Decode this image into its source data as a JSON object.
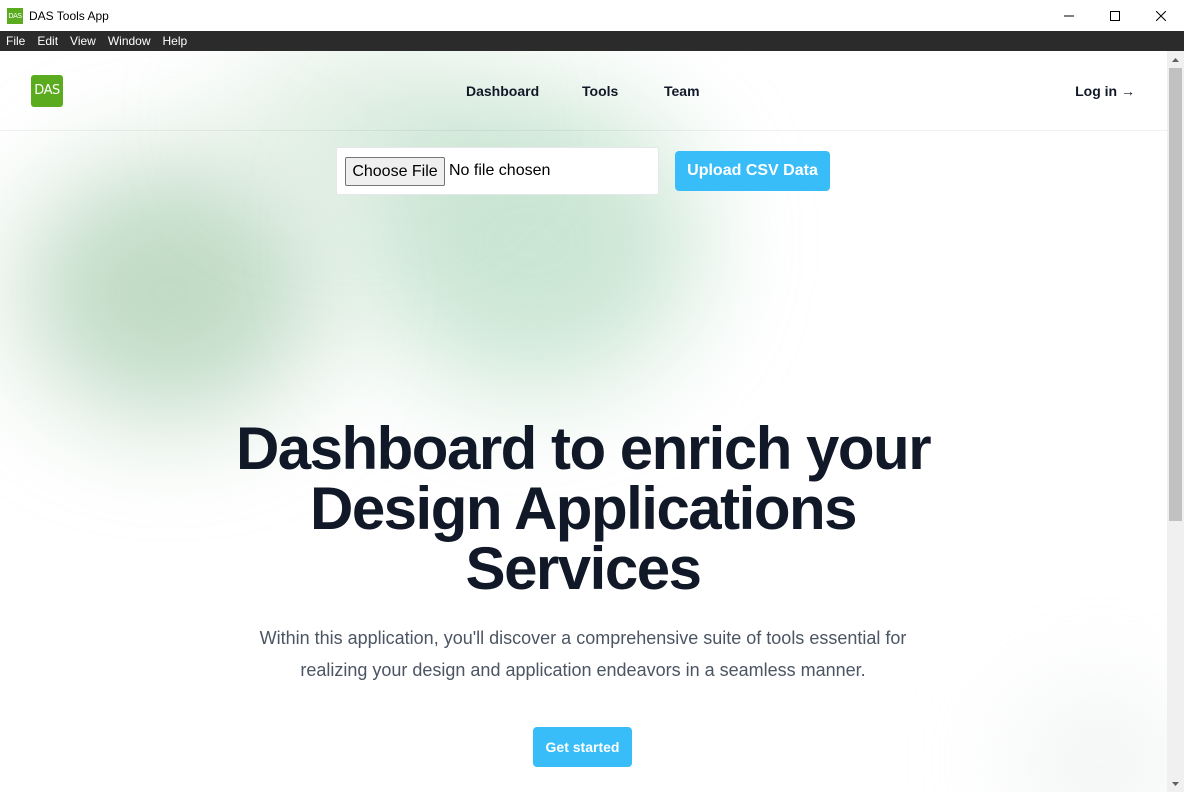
{
  "window": {
    "app_icon_text": "DAS",
    "title": "DAS Tools App"
  },
  "menu": {
    "items": [
      "File",
      "Edit",
      "View",
      "Window",
      "Help"
    ]
  },
  "header": {
    "logo_text": "DAS",
    "nav": [
      "Dashboard",
      "Tools",
      "Team"
    ],
    "login_label": "Log in →"
  },
  "upload": {
    "choose_label": "Choose File",
    "file_status": "No file chosen",
    "upload_label": "Upload CSV Data"
  },
  "hero": {
    "title_lines": [
      "Dashboard to enrich your",
      "Design Applications",
      "Services"
    ],
    "subtitle_lines": [
      "Within this application, you'll discover a comprehensive suite of tools essential for",
      "realizing your design and application endeavors in a seamless manner."
    ],
    "cta_label": "Get started"
  },
  "colors": {
    "brand_green": "#5aab1e",
    "accent_blue": "#38bdf8",
    "text_dark": "#111827",
    "text_muted": "#4b5563",
    "menubar_bg": "#2b2b2b"
  },
  "icons": {
    "minimize": "minimize-icon",
    "maximize": "maximize-icon",
    "close": "close-icon",
    "scroll_up": "chevron-up-icon",
    "scroll_down": "chevron-down-icon"
  }
}
